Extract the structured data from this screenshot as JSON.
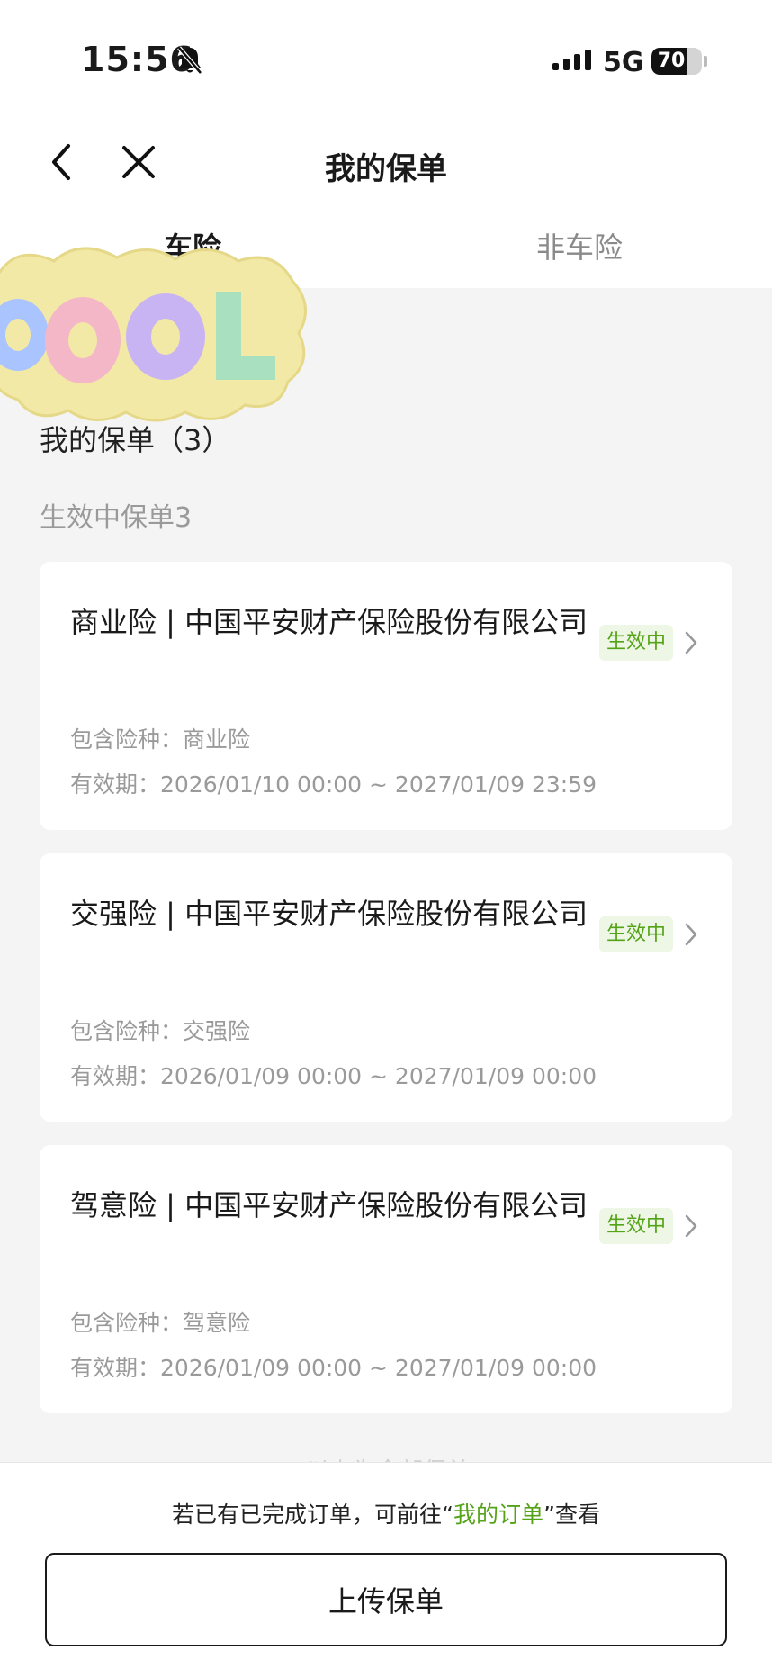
{
  "status_bar": {
    "time": "15:56",
    "network": "5G",
    "battery_percent": "70",
    "battery_level": 0.7,
    "icons": [
      "bell-muted-icon",
      "signal-icon"
    ]
  },
  "nav": {
    "title": "我的保单",
    "back_icon": "chevron-left-icon",
    "close_icon": "close-icon"
  },
  "tabs": [
    {
      "label": "车险",
      "active": true
    },
    {
      "label": "非车险",
      "active": false
    }
  ],
  "summary": {
    "title": "我的保单（3）",
    "section_label": "生效中保单3"
  },
  "policies": [
    {
      "title": "商业险 | 中国平安财产保险股份有限公司",
      "status": "生效中",
      "coverage": "包含险种：商业险",
      "validity": "有效期：2026/01/10 00:00 ~ 2027/01/09 23:59"
    },
    {
      "title": "交强险 | 中国平安财产保险股份有限公司",
      "status": "生效中",
      "coverage": "包含险种：交强险",
      "validity": "有效期：2026/01/09 00:00 ~ 2027/01/09 00:00"
    },
    {
      "title": "驾意险 | 中国平安财产保险股份有限公司",
      "status": "生效中",
      "coverage": "包含险种：驾意险",
      "validity": "有效期：2026/01/09 00:00 ~ 2027/01/09 00:00"
    }
  ],
  "bottom": {
    "note_prefix": "若已有已完成订单，可前往“",
    "note_link": "我的订单",
    "note_suffix": "”查看",
    "upload_label": "上传保单",
    "faded_text": "以上为全部保单"
  },
  "sticker_text": "COOL",
  "colors": {
    "accent_green": "#55a318",
    "badge_bg": "#eef7e6",
    "page_bg": "#f4f4f4"
  }
}
